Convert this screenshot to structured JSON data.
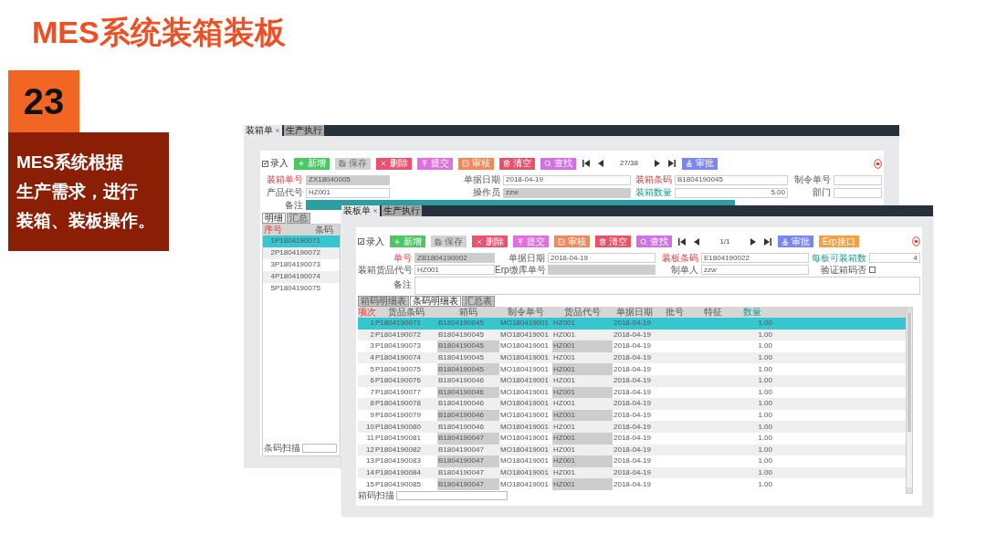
{
  "slide": {
    "title": "MES系统装箱装板",
    "number": "23",
    "description": [
      "MES系统根据",
      "生产需求，进行",
      "装箱、装板操作。"
    ]
  },
  "back_window": {
    "tabs": [
      {
        "label": "装箱单",
        "closable": true,
        "selected": true
      },
      {
        "label": "生产执行",
        "closable": false,
        "selected": false
      }
    ],
    "entry": {
      "label": "录入",
      "checked": true
    },
    "buttons": [
      {
        "label": "新增",
        "kind": "add",
        "color": "#4cc764",
        "disabled": false
      },
      {
        "label": "保存",
        "kind": "save",
        "disabled": true
      },
      {
        "label": "删除",
        "kind": "delete",
        "color": "#f0506e",
        "disabled": false
      },
      {
        "label": "提交",
        "kind": "submit",
        "color": "#e070e0",
        "disabled": false
      },
      {
        "label": "审核",
        "kind": "review",
        "color": "#ee8a5a",
        "disabled": false
      },
      {
        "label": "清空",
        "kind": "clear",
        "color": "#ea5068",
        "disabled": false
      },
      {
        "label": "查找",
        "kind": "find",
        "color": "#d070e8",
        "disabled": false
      }
    ],
    "pager": "27/38",
    "buttons_after": [
      {
        "label": "审批",
        "kind": "approve",
        "color": "#7b87f0",
        "disabled": false
      }
    ],
    "fields": [
      {
        "label": "装箱单号",
        "value": "ZX18040005",
        "kind": "required",
        "readonly": true
      },
      {
        "label": "单据日期",
        "value": "2018-04-19",
        "kind": "plain",
        "readonly": false
      },
      {
        "label": "装箱条码",
        "value": "B1804190045",
        "kind": "required",
        "readonly": false
      },
      {
        "label": "制令单号",
        "kind": "plain",
        "readonly": false
      },
      {
        "label": "产品代号",
        "value": "HZ001",
        "kind": "plain",
        "readonly": false
      },
      {
        "label": "操作员",
        "value": "zzw",
        "kind": "plain",
        "readonly": true
      },
      {
        "label": "装箱数量",
        "value": "5.00",
        "kind": "quantity",
        "readonly": false
      },
      {
        "label": "部门",
        "kind": "plain",
        "readonly": false
      }
    ],
    "remark": {
      "label": "备注",
      "focused": true
    },
    "list": {
      "subtabs": [
        {
          "label": "明细",
          "selected": true
        },
        {
          "label": "汇总",
          "selected": false
        }
      ],
      "columns": [
        {
          "label": "序号",
          "kind": "key"
        },
        {
          "label": "条码",
          "kind": "plain"
        }
      ],
      "rows": [
        {
          "index": "1",
          "barcode": "P1804190071",
          "selected": true
        },
        {
          "index": "2",
          "barcode": "P1804190072",
          "selected": false
        },
        {
          "index": "3",
          "barcode": "P1804190073",
          "selected": false
        },
        {
          "index": "4",
          "barcode": "P1804190074",
          "selected": false
        },
        {
          "index": "5",
          "barcode": "P1804190075",
          "selected": false
        }
      ],
      "scan_label": "条码扫描"
    }
  },
  "front_window": {
    "tabs": [
      {
        "label": "装板单",
        "closable": true,
        "selected": true
      },
      {
        "label": "生产执行",
        "closable": false,
        "selected": false
      }
    ],
    "entry": {
      "label": "录入",
      "checked": true
    },
    "buttons": [
      {
        "label": "新增",
        "kind": "add",
        "color": "#4cc764",
        "disabled": false
      },
      {
        "label": "保存",
        "kind": "save",
        "disabled": true
      },
      {
        "label": "删除",
        "kind": "delete",
        "color": "#f0506e",
        "disabled": false
      },
      {
        "label": "提交",
        "kind": "submit",
        "color": "#e070e0",
        "disabled": false
      },
      {
        "label": "审核",
        "kind": "review",
        "color": "#ee8a5a",
        "disabled": false
      },
      {
        "label": "清空",
        "kind": "clear",
        "color": "#ea5068",
        "disabled": false
      },
      {
        "label": "查找",
        "kind": "find",
        "color": "#d070e8",
        "disabled": false
      }
    ],
    "pager": "1/1",
    "buttons_after": [
      {
        "label": "审批",
        "kind": "approve",
        "color": "#7b87f0",
        "disabled": false
      },
      {
        "label": "Erp接口",
        "kind": "erp",
        "color": "#f8a040",
        "disabled": false
      }
    ],
    "fields": [
      {
        "label": "单号",
        "value": "ZB1804190002",
        "kind": "required",
        "readonly": true
      },
      {
        "label": "单据日期",
        "value": "2018-04-19",
        "kind": "plain",
        "readonly": false
      },
      {
        "label": "装板条码",
        "value": "E1804190022",
        "kind": "required",
        "readonly": false
      },
      {
        "label": "每板可装箱数",
        "value": "4",
        "kind": "quantity",
        "readonly": false
      },
      {
        "label": "装箱货品代号",
        "value": "HZ001",
        "kind": "plain",
        "readonly": false
      },
      {
        "label": "Erp缴库单号",
        "kind": "plain",
        "readonly": true
      },
      {
        "label": "制单人",
        "value": "zzw",
        "kind": "plain",
        "readonly": false
      },
      {
        "label": "验证箱码否",
        "kind": "checkbox",
        "checked": false
      }
    ],
    "remark": {
      "label": "备注",
      "focused": false
    },
    "subtabs": [
      {
        "label": "箱码明细表",
        "selected": false
      },
      {
        "label": "条码明细表",
        "selected": true
      },
      {
        "label": "汇总表",
        "selected": false
      }
    ],
    "table": {
      "columns": [
        {
          "label": "项次",
          "kind": "key"
        },
        {
          "label": "货品条码",
          "kind": "plain"
        },
        {
          "label": "箱码",
          "kind": "plain",
          "readonly": true
        },
        {
          "label": "制令单号",
          "kind": "plain"
        },
        {
          "label": "货品代号",
          "kind": "plain",
          "readonly": true
        },
        {
          "label": "单据日期",
          "kind": "plain"
        },
        {
          "label": "批号",
          "kind": "plain"
        },
        {
          "label": "特征",
          "kind": "plain"
        },
        {
          "label": "数量",
          "kind": "quantity"
        }
      ],
      "rows": [
        {
          "index": "1",
          "barcode": "P1804190071",
          "box_code": "B1804190045",
          "order_no": "MO180419001",
          "product_code": "HZ001",
          "date": "2018-04-19",
          "quantity": "1.00",
          "selected": true
        },
        {
          "index": "2",
          "barcode": "P1804190072",
          "box_code": "B1804190045",
          "order_no": "MO180419001",
          "product_code": "HZ001",
          "date": "2018-04-19",
          "quantity": "1.00",
          "selected": false
        },
        {
          "index": "3",
          "barcode": "P1804190073",
          "box_code": "B1804190045",
          "order_no": "MO180419001",
          "product_code": "HZ001",
          "date": "2018-04-19",
          "quantity": "1.00",
          "selected": false
        },
        {
          "index": "4",
          "barcode": "P1804190074",
          "box_code": "B1804190045",
          "order_no": "MO180419001",
          "product_code": "HZ001",
          "date": "2018-04-19",
          "quantity": "1.00",
          "selected": false
        },
        {
          "index": "5",
          "barcode": "P1804190075",
          "box_code": "B1804190045",
          "order_no": "MO180419001",
          "product_code": "HZ001",
          "date": "2018-04-19",
          "quantity": "1.00",
          "selected": false
        },
        {
          "index": "6",
          "barcode": "P1804190076",
          "box_code": "B1804190046",
          "order_no": "MO180419001",
          "product_code": "HZ001",
          "date": "2018-04-19",
          "quantity": "1.00",
          "selected": false
        },
        {
          "index": "7",
          "barcode": "P1804190077",
          "box_code": "B1804190046",
          "order_no": "MO180419001",
          "product_code": "HZ001",
          "date": "2018-04-19",
          "quantity": "1.00",
          "selected": false
        },
        {
          "index": "8",
          "barcode": "P1804190078",
          "box_code": "B1804190046",
          "order_no": "MO180419001",
          "product_code": "HZ001",
          "date": "2018-04-19",
          "quantity": "1.00",
          "selected": false
        },
        {
          "index": "9",
          "barcode": "P1804190079",
          "box_code": "B1804190046",
          "order_no": "MO180419001",
          "product_code": "HZ001",
          "date": "2018-04-19",
          "quantity": "1.00",
          "selected": false
        },
        {
          "index": "10",
          "barcode": "P1804190080",
          "box_code": "B1804190046",
          "order_no": "MO180419001",
          "product_code": "HZ001",
          "date": "2018-04-19",
          "quantity": "1.00",
          "selected": false
        },
        {
          "index": "11",
          "barcode": "P1804190081",
          "box_code": "B1804190047",
          "order_no": "MO180419001",
          "product_code": "HZ001",
          "date": "2018-04-19",
          "quantity": "1.00",
          "selected": false
        },
        {
          "index": "12",
          "barcode": "P1804190082",
          "box_code": "B1804190047",
          "order_no": "MO180419001",
          "product_code": "HZ001",
          "date": "2018-04-19",
          "quantity": "1.00",
          "selected": false
        },
        {
          "index": "13",
          "barcode": "P1804190083",
          "box_code": "B1804190047",
          "order_no": "MO180419001",
          "product_code": "HZ001",
          "date": "2018-04-19",
          "quantity": "1.00",
          "selected": false
        },
        {
          "index": "14",
          "barcode": "P1804190084",
          "box_code": "B1804190047",
          "order_no": "MO180419001",
          "product_code": "HZ001",
          "date": "2018-04-19",
          "quantity": "1.00",
          "selected": false
        },
        {
          "index": "15",
          "barcode": "P1804190085",
          "box_code": "B1804190047",
          "order_no": "MO180419001",
          "product_code": "HZ001",
          "date": "2018-04-19",
          "quantity": "1.00",
          "selected": false
        }
      ]
    },
    "scan_label": "箱码扫描"
  }
}
